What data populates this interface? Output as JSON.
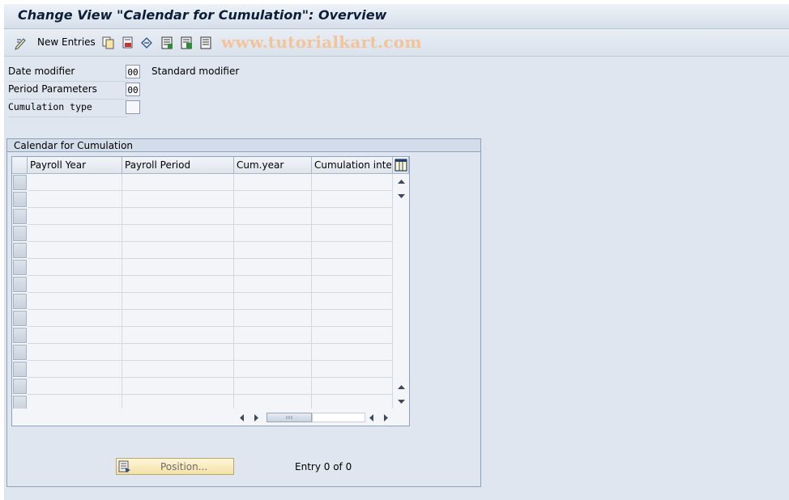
{
  "window": {
    "title": "Change View \"Calendar for Cumulation\": Overview"
  },
  "toolbar": {
    "new_entries_label": "New Entries",
    "watermark": "www.tutorialkart.com",
    "icons": [
      "edit-pencil-icon",
      "copy-icon",
      "delete-icon",
      "undo-icon",
      "select-all-icon",
      "select-block-icon",
      "deselect-all-icon"
    ]
  },
  "fields": [
    {
      "label": "Date modifier",
      "value": "00",
      "description": "Standard modifier"
    },
    {
      "label": "Period Parameters",
      "value": "00",
      "description": ""
    },
    {
      "label": "Cumulation type",
      "value": "",
      "description": ""
    }
  ],
  "group": {
    "title": "Calendar for Cumulation"
  },
  "table": {
    "columns": [
      "Payroll Year",
      "Payroll Period",
      "Cum.year",
      "Cumulation inte"
    ],
    "rows": [
      [
        "",
        "",
        "",
        ""
      ],
      [
        "",
        "",
        "",
        ""
      ],
      [
        "",
        "",
        "",
        ""
      ],
      [
        "",
        "",
        "",
        ""
      ],
      [
        "",
        "",
        "",
        ""
      ],
      [
        "",
        "",
        "",
        ""
      ],
      [
        "",
        "",
        "",
        ""
      ],
      [
        "",
        "",
        "",
        ""
      ],
      [
        "",
        "",
        "",
        ""
      ],
      [
        "",
        "",
        "",
        ""
      ],
      [
        "",
        "",
        "",
        ""
      ],
      [
        "",
        "",
        "",
        ""
      ],
      [
        "",
        "",
        "",
        ""
      ],
      [
        "",
        "",
        "",
        ""
      ]
    ]
  },
  "footer": {
    "position_button_label": "Position...",
    "entry_text": "Entry 0 of 0"
  },
  "colors": {
    "background": "#dfe6ef",
    "title": "#0c1e38",
    "watermark": "#f2c49a",
    "position_button": "#f4e1a6"
  }
}
